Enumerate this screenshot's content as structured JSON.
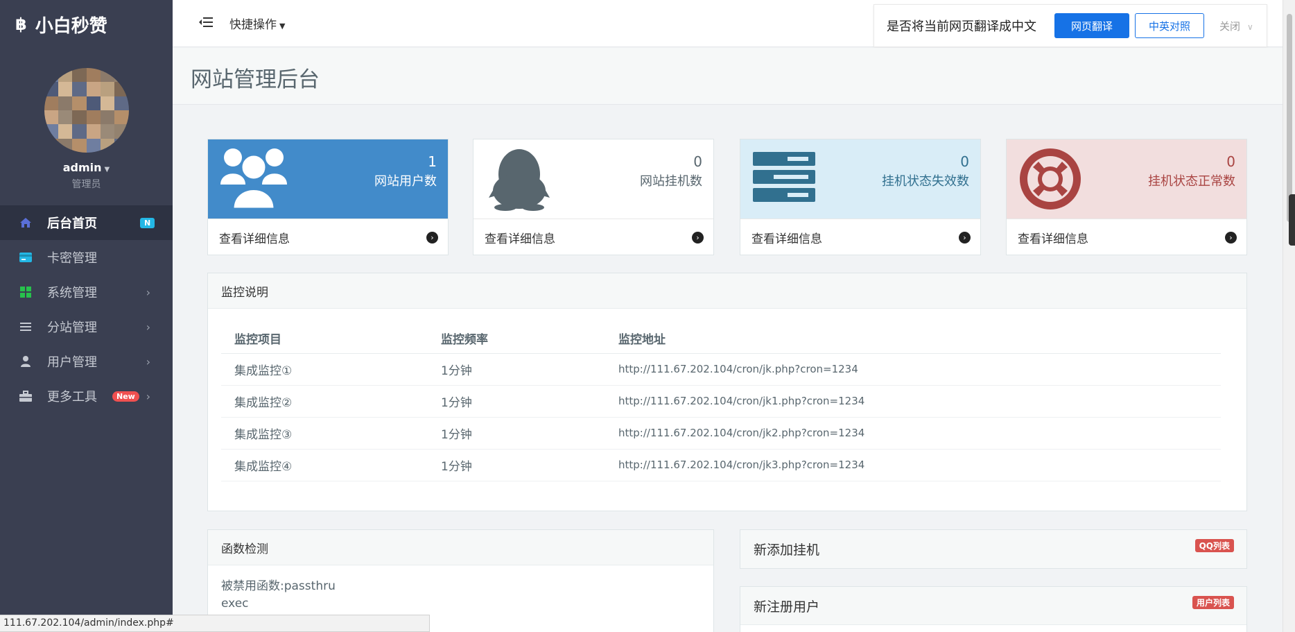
{
  "brand": {
    "icon": "bitcoin-icon",
    "title": "小白秒赞"
  },
  "user": {
    "name": "admin",
    "role": "管理员"
  },
  "sidebar": {
    "items": [
      {
        "label": "后台首页",
        "icon": "home-icon",
        "badge": "N",
        "active": true
      },
      {
        "label": "卡密管理",
        "icon": "credit-card-icon"
      },
      {
        "label": "系统管理",
        "icon": "grid-icon"
      },
      {
        "label": "分站管理",
        "icon": "list-icon"
      },
      {
        "label": "用户管理",
        "icon": "user-icon"
      },
      {
        "label": "更多工具",
        "icon": "toolbox-icon",
        "badge": "New"
      }
    ]
  },
  "topbar": {
    "quick_label": "快捷操作"
  },
  "translate_bar": {
    "question": "是否将当前网页翻译成中文",
    "translate_btn": "网页翻译",
    "compare_btn": "中英对照",
    "close_label": "关闭"
  },
  "page": {
    "title": "网站管理后台"
  },
  "cards": [
    {
      "value": "1",
      "label": "网站用户数",
      "footer": "查看详细信息",
      "icon": "users-icon",
      "bg": "#428bca",
      "color": "#ffffff"
    },
    {
      "value": "0",
      "label": "网站挂机数",
      "footer": "查看详细信息",
      "icon": "qq-penguin-icon",
      "bg": "#ffffff",
      "color": "#58666e"
    },
    {
      "value": "0",
      "label": "挂机状态失效数",
      "footer": "查看详细信息",
      "icon": "server-icon",
      "bg": "#d9edf7",
      "color": "#31708f"
    },
    {
      "value": "0",
      "label": "挂机状态正常数",
      "footer": "查看详细信息",
      "icon": "life-ring-icon",
      "bg": "#f2dede",
      "color": "#a94442"
    }
  ],
  "monitor": {
    "title": "监控说明",
    "headers": [
      "监控项目",
      "监控频率",
      "监控地址"
    ],
    "rows": [
      [
        "集成监控①",
        "1分钟",
        "http://111.67.202.104/cron/jk.php?cron=1234"
      ],
      [
        "集成监控②",
        "1分钟",
        "http://111.67.202.104/cron/jk1.php?cron=1234"
      ],
      [
        "集成监控③",
        "1分钟",
        "http://111.67.202.104/cron/jk2.php?cron=1234"
      ],
      [
        "集成监控④",
        "1分钟",
        "http://111.67.202.104/cron/jk3.php?cron=1234"
      ]
    ]
  },
  "func_check": {
    "title": "函数检测",
    "line1": "被禁用函数:passthru",
    "line2": "exec"
  },
  "new_hang": {
    "title": "新添加挂机",
    "tag": "QQ列表"
  },
  "new_user": {
    "title": "新注册用户",
    "tag": "用户列表"
  },
  "statusbar": {
    "url": "111.67.202.104/admin/index.php#"
  },
  "colors": {
    "sidebar_bg": "#3a3f51",
    "accent_blue": "#1672e6",
    "badge_red": "#d9534f"
  }
}
